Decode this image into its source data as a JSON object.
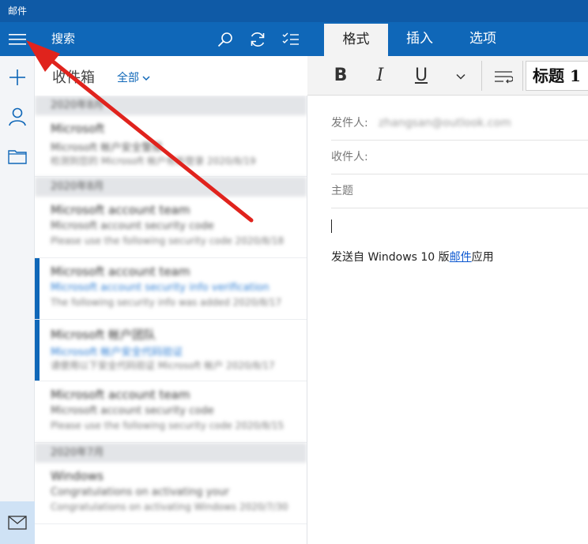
{
  "window": {
    "title": "邮件"
  },
  "rail": {
    "menu_icon": "hamburger-icon",
    "items": [
      {
        "icon": "plus-icon",
        "label": "new-mail"
      },
      {
        "icon": "person-icon",
        "label": "accounts"
      },
      {
        "icon": "folder-icon",
        "label": "folders"
      }
    ],
    "mail_icon": "envelope-icon"
  },
  "list_header": {
    "search_label": "搜索",
    "icons": [
      "search-icon",
      "sync-icon",
      "select-mode-icon"
    ]
  },
  "inbox": {
    "title": "收件箱",
    "filter": "全部"
  },
  "mail_list": [
    {
      "type": "group",
      "label": "2020年8月"
    },
    {
      "type": "item",
      "unread": false,
      "sender": "Microsoft",
      "subject": "Microsoft 帐户安全警报",
      "preview": "检测到您的 Microsoft 帐户有新登录 2020/8/19"
    },
    {
      "type": "group",
      "label": "2020年8月"
    },
    {
      "type": "item",
      "unread": false,
      "sender": "Microsoft account team",
      "subject": "Microsoft account security code",
      "preview": "Please use the following security code 2020/8/18"
    },
    {
      "type": "item",
      "unread": true,
      "sender": "Microsoft account team",
      "subject": "Microsoft account security info verification",
      "preview": "The following security info was added 2020/8/17",
      "blue": true
    },
    {
      "type": "item",
      "unread": true,
      "sender": "Microsoft 帐户团队",
      "subject": "Microsoft 帐户安全代码验证",
      "preview": "请使用以下安全代码验证 Microsoft 帐户 2020/8/17",
      "blue": true
    },
    {
      "type": "item",
      "unread": false,
      "sender": "Microsoft account team",
      "subject": "Microsoft account security code",
      "preview": "Please use the following security code 2020/8/15"
    },
    {
      "type": "group",
      "label": "2020年7月"
    },
    {
      "type": "item",
      "unread": false,
      "sender": "Windows",
      "subject": "Congratulations on activating your",
      "preview": "Congratulations on activating Windows 2020/7/30"
    }
  ],
  "compose": {
    "tabs": [
      {
        "label": "格式",
        "active": true
      },
      {
        "label": "插入",
        "active": false
      },
      {
        "label": "选项",
        "active": false
      }
    ],
    "ribbon": {
      "bold": "B",
      "italic": "I",
      "underline": "U",
      "style_name": "标题 1"
    },
    "from_label": "发件人:",
    "from_value": "zhangsan@outlook.com",
    "to_label": "收件人:",
    "subject_label": "主题",
    "signature_prefix": "发送自 Windows 10 版",
    "signature_link": "邮件",
    "signature_suffix": "应用"
  },
  "colors": {
    "accent": "#0f67b8",
    "title_bar": "#0f5aa6",
    "annotation_arrow": "#e0231d"
  }
}
